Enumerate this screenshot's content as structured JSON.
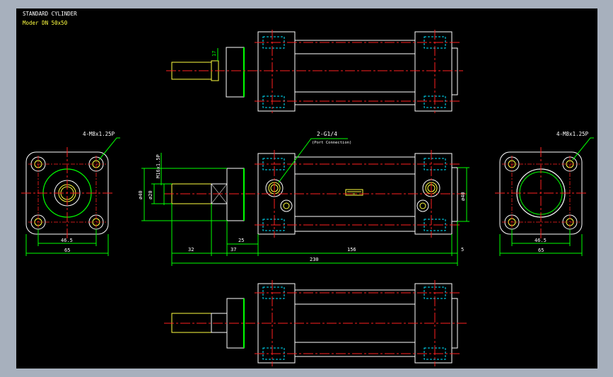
{
  "title": {
    "main": "STANDARD CYLINDER",
    "model": "Moder DN 50x50"
  },
  "annotations": {
    "left_thread": "4-M8x1.25P",
    "right_thread": "4-M8x1.25P",
    "port": "2-G1/4",
    "port_note": "(Port Connection)"
  },
  "dimensions": {
    "d17": "17",
    "d_thread": "M16x1.5P",
    "d_phi40": "ø40",
    "d_phi20": "ø20",
    "d_phi40_right": "ø40",
    "d32": "32",
    "d37": "37",
    "d25": "25",
    "d156": "156",
    "d5": "5",
    "d230": "230",
    "left_46_5": "46.5",
    "left_65": "65",
    "right_46_5": "46.5",
    "right_65": "65"
  },
  "colors": {
    "background": "#000000",
    "frame": "#a7b0bd",
    "outline": "#ffffff",
    "dimension": "#00ff00",
    "centerline": "#ff2020",
    "hidden": "#00e5ff",
    "rod": "#ffff40"
  }
}
